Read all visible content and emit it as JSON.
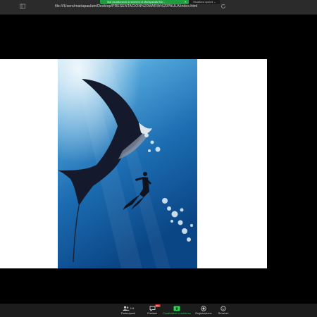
{
  "browser": {
    "url": "file:///Users/mariapaulam/Desktop/PRESENTACION%20MARIA%20PAULA/index.html"
  },
  "share_banner": {
    "text": "Stai visualizzando lo schermo di MariapaolaM Ma..."
  },
  "view_options": {
    "label": "Visualizza opzioni ⌄"
  },
  "toolbar": {
    "participants": {
      "label": "Partecipanti",
      "count": "144"
    },
    "chat": {
      "label": "Chattare",
      "badge": "99+"
    },
    "share": {
      "label": "Condividere lo schermo"
    },
    "record": {
      "label": "Registrazione"
    },
    "reactions": {
      "label": "Reazioni"
    }
  },
  "colors": {
    "share_green": "#1e9e3e",
    "ocean_top": "#9fd3ec",
    "ocean_bottom": "#0c4e8a",
    "manta": "#151a2a"
  },
  "icons": [
    "sidebar-icon",
    "reload-icon",
    "people-icon",
    "chat-icon",
    "share-screen-icon",
    "record-icon",
    "reactions-icon"
  ]
}
